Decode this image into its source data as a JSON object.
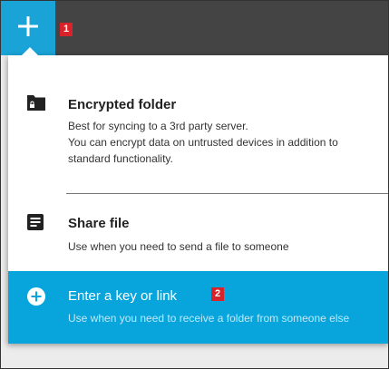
{
  "toolbar": {
    "add_icon": "plus-icon",
    "annotation_1": "1"
  },
  "menu": {
    "encrypted_folder": {
      "icon": "folder-lock-icon",
      "title": "Encrypted folder",
      "desc_line1": "Best for syncing to a 3rd party server.",
      "desc_line2": "You can encrypt data on untrusted devices in addition to",
      "desc_line3": "standard functionality."
    },
    "share_file": {
      "icon": "document-icon",
      "title": "Share file",
      "desc": "Use when you need to send a file to someone"
    },
    "enter_key": {
      "icon": "plus-circle-icon",
      "title": "Enter a key or link",
      "desc": "Use when you need to receive a folder from someone else",
      "annotation_2": "2"
    }
  },
  "colors": {
    "accent": "#1aa3d6",
    "highlight": "#07a5dc",
    "topbar": "#444444",
    "badge": "#d8232a"
  }
}
